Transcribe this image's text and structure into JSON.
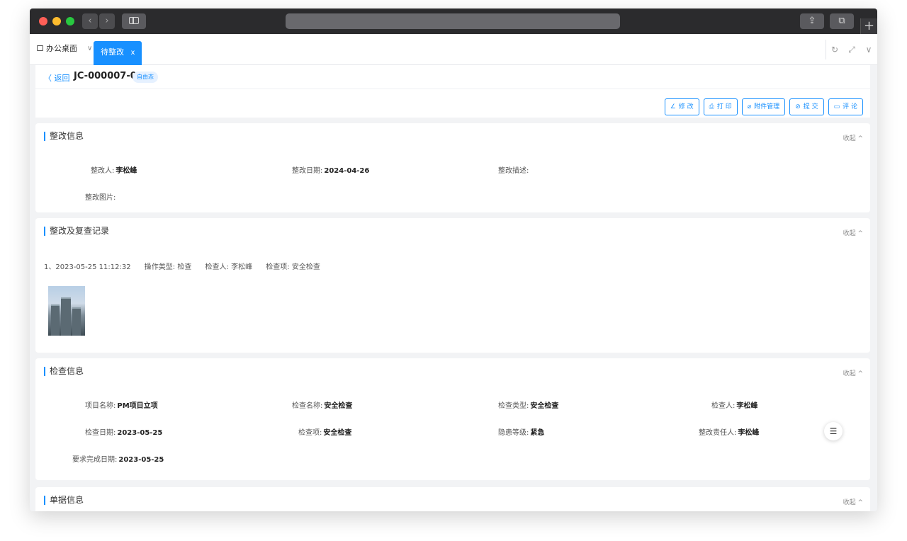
{
  "browser": {
    "back_glyph": "‹",
    "forward_glyph": "›",
    "new_tab_glyph": "+"
  },
  "tabs": {
    "desktop_label": "办公桌面",
    "active_label": "待整改",
    "active_close": "x"
  },
  "header": {
    "back_label": "〈 返回",
    "doc_number": "JC-000007-01",
    "badge": "自由态"
  },
  "actions": [
    {
      "icon": "edit-icon",
      "glyph": "∠",
      "label": "修 改"
    },
    {
      "icon": "print-icon",
      "glyph": "⎙",
      "label": "打 印"
    },
    {
      "icon": "paperclip-icon",
      "glyph": "⌀",
      "label": "附件管理"
    },
    {
      "icon": "check-circle-icon",
      "glyph": "⊘",
      "label": "提 交"
    },
    {
      "icon": "comment-icon",
      "glyph": "▭",
      "label": "评 论"
    }
  ],
  "collapse_label": "收起 ^",
  "rectify_info": {
    "title": "整改信息",
    "person_label": "整改人:",
    "person_value": "李松峰",
    "date_label": "整改日期:",
    "date_value": "2024-04-26",
    "desc_label": "整改描述:",
    "desc_value": "",
    "image_label": "整改图片:"
  },
  "records": {
    "title": "整改及复查记录",
    "entry": {
      "index_time": "1、2023-05-25 11:12:32",
      "op_type": "操作类型: 检查",
      "inspector": "检查人: 李松峰",
      "item": "检查项: 安全检查"
    }
  },
  "inspection_info": {
    "title": "检查信息",
    "fields": {
      "project_label": "项目名称:",
      "project_value": "PM项目立项",
      "name_label": "检查名称:",
      "name_value": "安全检查",
      "type_label": "检查类型:",
      "type_value": "安全检查",
      "inspector_label": "检查人:",
      "inspector_value": "李松峰",
      "date_label": "检查日期:",
      "date_value": "2023-05-25",
      "item_label": "检查项:",
      "item_value": "安全检查",
      "level_label": "隐患等级:",
      "level_value": "紧急",
      "owner_label": "整改责任人:",
      "owner_value": "李松峰",
      "due_label": "要求完成日期:",
      "due_value": "2023-05-25"
    }
  },
  "document_info": {
    "title": "单据信息"
  },
  "colors": {
    "accent": "#1890ff",
    "page_bg": "#f2f3f5",
    "titlebar": "#2b2b2d"
  }
}
